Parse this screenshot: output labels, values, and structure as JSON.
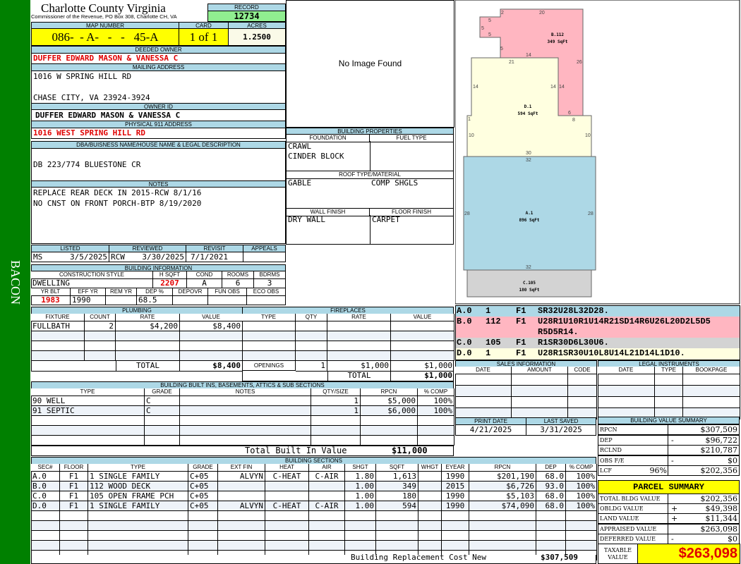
{
  "sidebar": {
    "label": "BACON",
    "color": "#008000"
  },
  "header": {
    "title": "Charlotte County Virginia",
    "subtitle": "Commissioner of the Revenue, PO Box 308, Charlotte CH, VA",
    "record_label": "RECORD",
    "record": "12734"
  },
  "parcel": {
    "map_label": "MAP NUMBER",
    "map": "086-  - A-   -   -   45-A",
    "card_label": "CARD",
    "card": "1 of 1",
    "acres_label": "ACRES",
    "acres": "1.2500"
  },
  "owner": {
    "deeded_label": "DEEDED OWNER",
    "deeded": "DUFFER EDWARD MASON & VANESSA C",
    "mailing_label": "MAILING ADDRESS",
    "mail1": "1016 W SPRING HILL RD",
    "mail2": "CHASE CITY, VA 23924-3924",
    "ownerid_label": "OWNER ID",
    "ownerid": "DUFFER EDWARD MASON & VANESSA C",
    "phys_label": "PHYSICAL 911 ADDRESS",
    "phys": "1016 WEST SPRING HILL RD",
    "dba_label": "DBA/BUISNESS NAME/HOUSE NAME & LEGAL DESCRIPTION",
    "dba": "DB 223/774 BLUESTONE CR",
    "notes_label": "NOTES",
    "note1": "REPLACE REAR DECK IN 2015-RCW 8/1/16",
    "note2": "NO CNST ON FRONT PORCH-BTP 8/19/2020"
  },
  "review": {
    "listed_label": "LISTED",
    "listed_by": "MS",
    "listed": "3/5/2025",
    "reviewed_label": "REVIEWED",
    "reviewed_by": "RCW",
    "reviewed": "3/30/2025",
    "revisit_label": "REVISIT",
    "revisit": "7/1/2021",
    "appeals_label": "APPEALS"
  },
  "bldg": {
    "title": "BUILDING INFORMATION",
    "h": [
      "CONSTRUCTION STYLE",
      "H SQFT",
      "COND",
      "ROOMS",
      "BDRMS"
    ],
    "v": [
      "DWELLING",
      "2207",
      "A",
      "6",
      "3"
    ],
    "h2": [
      "YR BLT",
      "EFF YR",
      "REM YR",
      "DEP %",
      "DEPOVR",
      "FUN OBS",
      "ECO OBS"
    ],
    "v2": [
      "1983",
      "1990",
      "",
      "68.5",
      "",
      "",
      ""
    ]
  },
  "image": {
    "text": "No Image Found"
  },
  "props": {
    "title": "BUILDING PROPERTIES",
    "foundation_label": "FOUNDATION",
    "fuel_label": "FUEL TYPE",
    "foundation1": "CRAWL",
    "foundation2": "CINDER BLOCK",
    "roof_label": "ROOF TYPE/MATERIAL",
    "roof1": "GABLE",
    "roof2": "COMP SHGLS",
    "wall_label": "WALL FINISH",
    "floor_label": "FLOOR FINISH",
    "wall": "DRY WALL",
    "floor": "CARPET"
  },
  "plumbing": {
    "title": "PLUMBING",
    "h": [
      "FIXTURE",
      "COUNT",
      "RATE",
      "VALUE"
    ],
    "rows": [
      [
        "FULLBATH",
        "2",
        "$4,200",
        "$8,400"
      ]
    ],
    "total_label": "TOTAL",
    "total": "$8,400"
  },
  "fireplaces": {
    "title": "FIREPLACES",
    "h": [
      "TYPE",
      "QTY",
      "RATE",
      "VALUE"
    ],
    "openings_label": "OPENINGS",
    "openings": [
      "1",
      "$1,000",
      "$1,000"
    ],
    "total_label": "TOTAL",
    "total": "$1,000"
  },
  "builtins": {
    "title": "BUILDING BUILT INS, BASEMENTS, ATTICS & SUB SECTIONS",
    "h": [
      "TYPE",
      "GRADE",
      "NOTES",
      "QTY/SIZE",
      "RPCN",
      "% COMP"
    ],
    "rows": [
      [
        "90 WELL",
        "C",
        "",
        "1",
        "$5,000",
        "100%"
      ],
      [
        "91 SEPTIC",
        "C",
        "",
        "1",
        "$6,000",
        "100%"
      ]
    ],
    "total_label": "Total Built In Value",
    "total": "$11,000"
  },
  "sections": {
    "title": "BUILDING SECTIONS",
    "h": [
      "SEC#",
      "FLOOR",
      "TYPE",
      "GRADE",
      "EXT FIN",
      "HEAT",
      "AIR",
      "SHGT",
      "SQFT",
      "WHGT",
      "EYEAR",
      "RPCN",
      "DEP",
      "% COMP"
    ],
    "rows": [
      [
        "A.0",
        "F1",
        "1 SINGLE FAMILY",
        "C+05",
        "ALVYN",
        "C-HEAT",
        "C-AIR",
        "1.80",
        "1,613",
        "",
        "1990",
        "$201,190",
        "68.0",
        "100%"
      ],
      [
        "B.0",
        "F1",
        "112 WOOD DECK",
        "C+05",
        "",
        "",
        "",
        "1.00",
        "349",
        "",
        "2015",
        "$6,726",
        "93.0",
        "100%"
      ],
      [
        "C.0",
        "F1",
        "105 OPEN FRAME PCH",
        "C+05",
        "",
        "",
        "",
        "1.00",
        "180",
        "",
        "1990",
        "$5,103",
        "68.0",
        "100%"
      ],
      [
        "D.0",
        "F1",
        "1 SINGLE FAMILY",
        "C+05",
        "ALVYN",
        "C-HEAT",
        "C-AIR",
        "1.00",
        "594",
        "",
        "1990",
        "$74,090",
        "68.0",
        "100%"
      ]
    ],
    "total_label": "Building Replacement Cost New",
    "total": "$307,509"
  },
  "sketch": {
    "areas": [
      {
        "label": "A.1",
        "sqft": "896 SqFt",
        "color": "#add8e6"
      },
      {
        "label": "B.112",
        "sqft": "349 SqFt",
        "color": "#ffb6c1"
      },
      {
        "label": "C.105",
        "sqft": "180 SqFt",
        "color": "#d3d3d3"
      },
      {
        "label": "D.1",
        "sqft": "594 SqFt",
        "color": "#ffffe0"
      }
    ],
    "codes": [
      {
        "sec": "A.0",
        "n": "1",
        "f": "F1",
        "code": "SR32U28L32D28.",
        "color": "#add8e6"
      },
      {
        "sec": "B.0",
        "n": "112",
        "f": "F1",
        "code": "U28R1U10R1U14R21SD14R6U26L20D2L5D5",
        "code2": "R5D5R14.",
        "color": "#ffb6c1"
      },
      {
        "sec": "C.0",
        "n": "105",
        "f": "F1",
        "code": "R1SR30D6L30U6.",
        "color": "#d3d3d3"
      },
      {
        "sec": "D.0",
        "n": "1",
        "f": "F1",
        "code": "U28R1SR30U10L8U14L21D14L1D10.",
        "color": "#ffffe0"
      }
    ]
  },
  "sales": {
    "title": "SALES INFORMATION",
    "h": [
      "DATE",
      "AMOUNT",
      "CODE"
    ]
  },
  "legal": {
    "title": "LEGAL INSTRUMENTS",
    "h": [
      "DATE",
      "TYPE",
      "BOOKPAGE"
    ]
  },
  "dates": {
    "print_label": "PRINT DATE",
    "print": "4/21/2025",
    "saved_label": "LAST SAVED",
    "saved": "3/31/2025"
  },
  "value_summary": {
    "title": "BUILDING VALUE SUMMARY",
    "rows": [
      [
        "RPCN",
        "",
        "",
        "$307,509"
      ],
      [
        "DEP",
        "",
        "-",
        "$96,722"
      ],
      [
        "RCLND",
        "",
        "",
        "$210,787"
      ],
      [
        "OBS F/E",
        "",
        "-",
        "$0"
      ],
      [
        "LCF",
        "96%",
        "",
        "$202,356"
      ]
    ]
  },
  "parcel_summary": {
    "title": "PARCEL SUMMARY",
    "rows": [
      [
        "TOTAL BLDG VALUE",
        "",
        "$202,356"
      ],
      [
        "OBLDG VALUE",
        "+",
        "$49,398"
      ],
      [
        "LAND VALUE",
        "+",
        "$11,344"
      ],
      [
        "APPRAISED VALUE",
        "",
        "$263,098"
      ],
      [
        "DEFERRED VALUE",
        "-",
        "$0"
      ]
    ],
    "taxable_label": "TAXABLE VALUE",
    "taxable": "$263,098"
  }
}
